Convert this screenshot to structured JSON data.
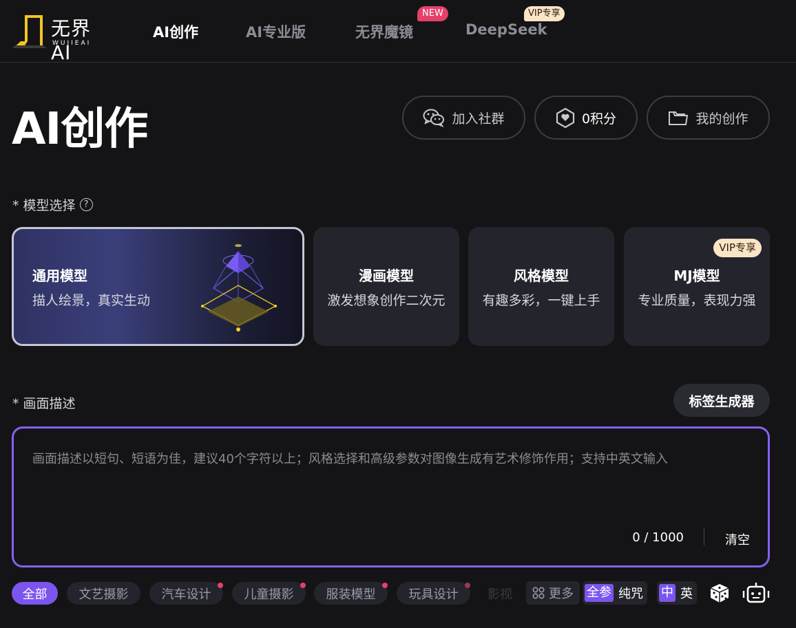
{
  "logo": {
    "text": "无界AI",
    "subtext": "WUJIEAI"
  },
  "nav": {
    "items": [
      {
        "label": "AI创作",
        "active": true
      },
      {
        "label": "AI专业版",
        "active": false
      },
      {
        "label": "无界魔镜",
        "active": false,
        "badge": "NEW"
      },
      {
        "label": "DeepSeek",
        "active": false,
        "badge": "VIP专享"
      }
    ]
  },
  "page": {
    "title": "AI创作"
  },
  "actions": {
    "join_community": "加入社群",
    "points": "0积分",
    "my_creations": "我的创作"
  },
  "model_section": {
    "label": "* 模型选择",
    "help": "?",
    "models": [
      {
        "name": "通用模型",
        "desc": "描人绘景，真实生动",
        "selected": true
      },
      {
        "name": "漫画模型",
        "desc": "激发想象创作二次元",
        "selected": false
      },
      {
        "name": "风格模型",
        "desc": "有趣多彩，一键上手",
        "selected": false
      },
      {
        "name": "MJ模型",
        "desc": "专业质量，表现力强",
        "selected": false,
        "badge": "VIP专享"
      }
    ]
  },
  "prompt_section": {
    "label": "* 画面描述",
    "tag_generator": "标签生成器",
    "placeholder": "画面描述以短句、短语为佳，建议40个字符以上；风格选择和高级参数对图像生成有艺术修饰作用；支持中英文输入",
    "counter": "0 / 1000",
    "clear": "清空"
  },
  "tags": {
    "items": [
      {
        "label": "全部",
        "active": true,
        "dot": false
      },
      {
        "label": "文艺摄影",
        "active": false,
        "dot": false
      },
      {
        "label": "汽车设计",
        "active": false,
        "dot": true
      },
      {
        "label": "儿童摄影",
        "active": false,
        "dot": true
      },
      {
        "label": "服装模型",
        "active": false,
        "dot": true
      },
      {
        "label": "玩具设计",
        "active": false,
        "dot": true
      },
      {
        "label": "影视",
        "active": false,
        "dot": false
      }
    ],
    "more": "更多",
    "mode_toggle": {
      "on": "全参",
      "off": "纯咒"
    },
    "lang_toggle": {
      "on": "中",
      "off": "英"
    }
  },
  "colors": {
    "accent": "#7b55ee",
    "badge_new": "#e5406b",
    "badge_vip": "#fce5c7",
    "background": "#141416"
  }
}
